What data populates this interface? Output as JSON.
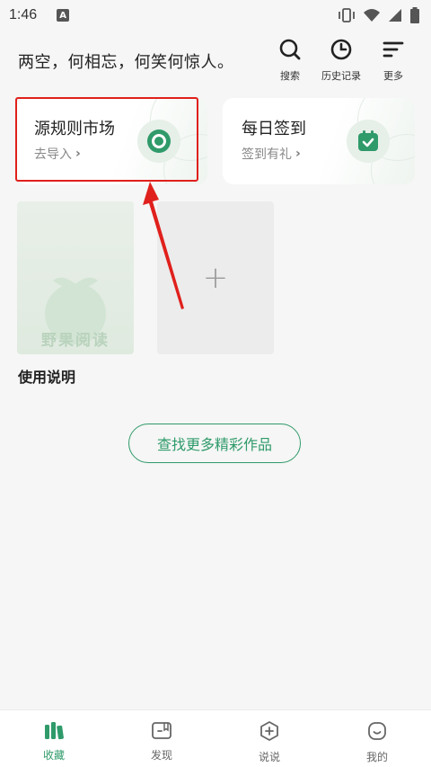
{
  "status_bar": {
    "time": "1:46",
    "notification_badge": "A"
  },
  "header": {
    "slogan": "两空，何相忘，何笑何惊人。",
    "actions": {
      "search": "搜索",
      "history": "历史记录",
      "more": "更多"
    }
  },
  "cards": {
    "source": {
      "title": "源规则市场",
      "subtitle": "去导入"
    },
    "signin": {
      "title": "每日签到",
      "subtitle": "签到有礼"
    }
  },
  "bookshelf": {
    "book": {
      "cover_text": "野果阅读",
      "title": "使用说明"
    }
  },
  "find_more_label": "查找更多精彩作品",
  "bottom_nav": {
    "items": [
      {
        "label": "收藏",
        "icon": "books-icon"
      },
      {
        "label": "发现",
        "icon": "book-open-icon"
      },
      {
        "label": "说说",
        "icon": "plus-chat-icon"
      },
      {
        "label": "我的",
        "icon": "smile-icon"
      }
    ],
    "active_index": 0
  },
  "colors": {
    "accent": "#2f9a6a",
    "highlight": "#e0201c",
    "background": "#f5f6f5"
  }
}
